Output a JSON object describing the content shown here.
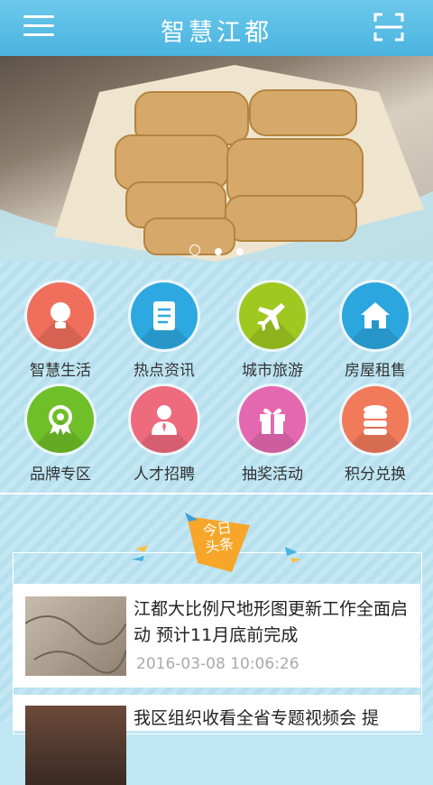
{
  "header": {
    "title": "智慧江都",
    "menu_icon": "menu-icon",
    "scan_icon": "scan-icon"
  },
  "banner": {
    "slide_count": 3,
    "active_index": 0
  },
  "colors": {
    "header": "#4ab4e0",
    "background": "#bfe6f2"
  },
  "services": [
    {
      "label": "智慧生活",
      "icon": "lightbulb-icon",
      "color": "#ef6f5c"
    },
    {
      "label": "热点资讯",
      "icon": "document-icon",
      "color": "#2ea8e0"
    },
    {
      "label": "城市旅游",
      "icon": "airplane-icon",
      "color": "#9fc820"
    },
    {
      "label": "房屋租售",
      "icon": "house-icon",
      "color": "#2ba6de"
    },
    {
      "label": "品牌专区",
      "icon": "award-icon",
      "color": "#6fbf28"
    },
    {
      "label": "人才招聘",
      "icon": "person-icon",
      "color": "#ee6a7d"
    },
    {
      "label": "抽奖活动",
      "icon": "gift-icon",
      "color": "#e468b0"
    },
    {
      "label": "积分兑换",
      "icon": "coins-icon",
      "color": "#f07a5a"
    }
  ],
  "news": {
    "badge": {
      "line1": "今日",
      "line2": "头条"
    },
    "items": [
      {
        "title": "江都大比例尺地形图更新工作全面启动 预计11月底前完成",
        "time": "2016-03-08 10:06:26"
      },
      {
        "title": "我区组织收看全省专题视频会 提"
      }
    ]
  }
}
